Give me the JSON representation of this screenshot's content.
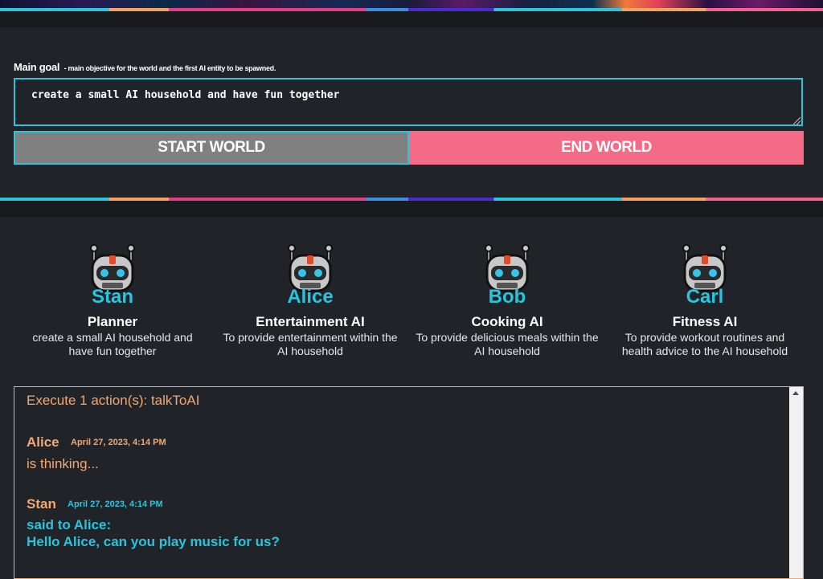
{
  "goal": {
    "label": "Main goal",
    "hint": "- main objective for the world and the first AI entity to be spawned.",
    "value": "create a small AI household and have fun together"
  },
  "buttons": {
    "start": "START WORLD",
    "end": "END WORLD"
  },
  "agents": [
    {
      "name": "Stan",
      "role": "Planner",
      "goal": "create a small AI household and have fun together"
    },
    {
      "name": "Alice",
      "role": "Entertainment AI",
      "goal": "To provide entertainment within the AI household"
    },
    {
      "name": "Bob",
      "role": "Cooking AI",
      "goal": "To provide delicious meals within the AI household"
    },
    {
      "name": "Carl",
      "role": "Fitness AI",
      "goal": "To provide workout routines and health advice to the AI household"
    }
  ],
  "log": {
    "header": "Execute 1 action(s): talkToAI",
    "messages": [
      {
        "name": "Alice",
        "time": "April 27, 2023, 4:14 PM",
        "line1": "is thinking...",
        "line2": ""
      },
      {
        "name": "Stan",
        "time": "April 27, 2023, 4:14 PM",
        "line1": "said to Alice:",
        "line2": "Hello Alice, can you play music for us?"
      }
    ]
  },
  "colors": {
    "accent": "#29c4dd",
    "end": "#f36b86",
    "orange": "#f3a873",
    "background": "#202328"
  }
}
